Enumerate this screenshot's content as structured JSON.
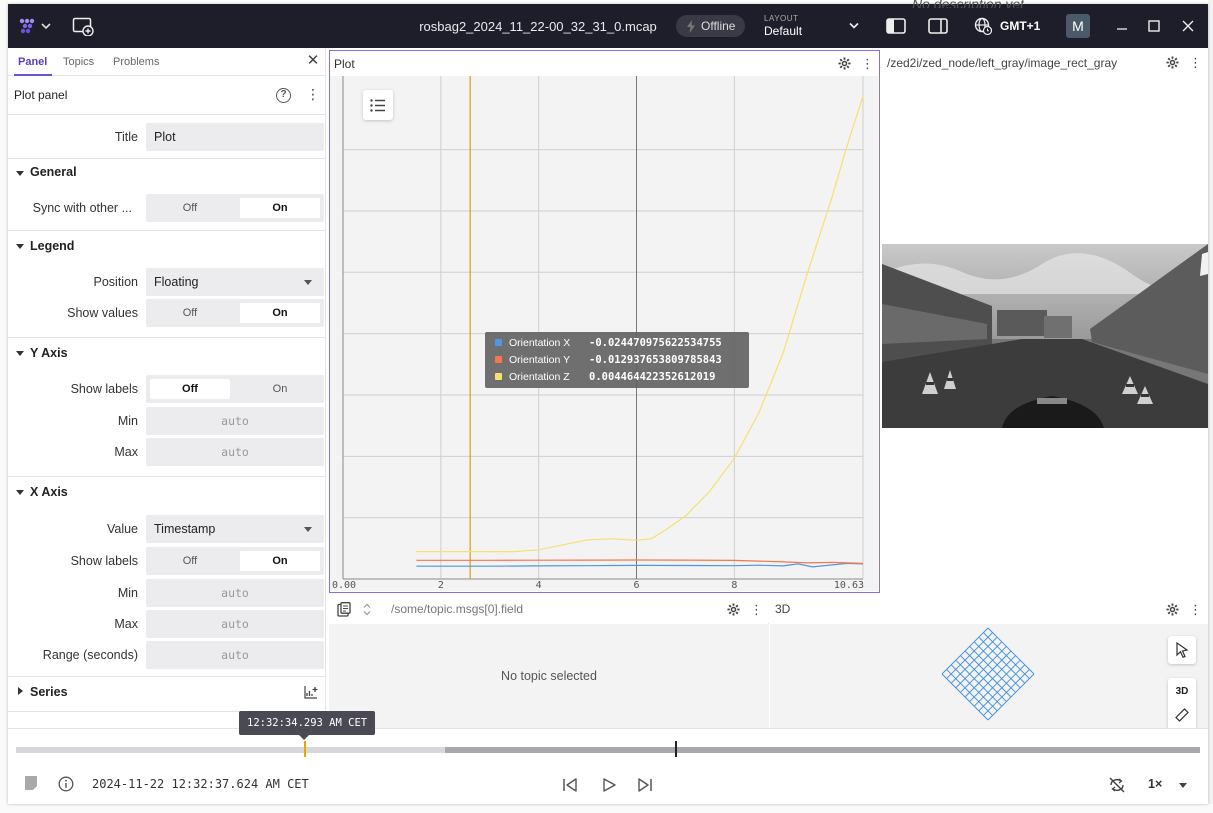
{
  "titlebar": {
    "file_name": "rosbag2_2024_11_22-00_32_31_0.mcap",
    "connection_status": "Offline",
    "layout_caption": "LAYOUT",
    "layout_value": "Default",
    "timezone": "GMT+1",
    "user_initial": "M",
    "behind_text": "No description yet"
  },
  "sidebar": {
    "tabs": [
      "Panel",
      "Topics",
      "Problems"
    ],
    "active_tab": "Panel",
    "header_title": "Plot panel",
    "help_symbol": "?",
    "title_label": "Title",
    "title_value": "Plot",
    "general": {
      "heading": "General",
      "sync_label": "Sync with other ...",
      "sync_off": "Off",
      "sync_on": "On",
      "sync_selected": "On"
    },
    "legend": {
      "heading": "Legend",
      "position_label": "Position",
      "position_value": "Floating",
      "show_values_label": "Show values",
      "off": "Off",
      "on": "On",
      "show_values_selected": "On"
    },
    "y_axis": {
      "heading": "Y Axis",
      "show_labels_label": "Show labels",
      "off": "Off",
      "on": "On",
      "show_labels_selected": "Off",
      "min_label": "Min",
      "min_value": "auto",
      "max_label": "Max",
      "max_value": "auto"
    },
    "x_axis": {
      "heading": "X Axis",
      "value_label": "Value",
      "value_value": "Timestamp",
      "show_labels_label": "Show labels",
      "off": "Off",
      "on": "On",
      "show_labels_selected": "On",
      "min_label": "Min",
      "min_value": "auto",
      "max_label": "Max",
      "max_value": "auto",
      "range_label": "Range (seconds)",
      "range_value": "auto"
    },
    "series": {
      "heading": "Series"
    }
  },
  "plot_panel": {
    "title": "Plot",
    "tooltip": [
      {
        "name": "Orientation X",
        "value": "-0.024470975622534755",
        "color": "#4e98e2"
      },
      {
        "name": "Orientation Y",
        "value": "-0.012937653809785843",
        "color": "#f5774d"
      },
      {
        "name": "Orientation Z",
        "value": "0.004464422352612019",
        "color": "#f7df71"
      }
    ]
  },
  "chart_data": {
    "type": "line",
    "title": "",
    "xlabel": "",
    "ylabel": "",
    "xlim": [
      0.0,
      10.63
    ],
    "x_tick_labels": [
      "0.00",
      "2",
      "4",
      "6",
      "8",
      "10.63"
    ],
    "x_ticks": [
      0,
      2,
      4,
      6,
      8,
      10.63
    ],
    "y_show_labels": false,
    "ylim": [
      -0.05,
      0.95
    ],
    "hover_x": 2.6,
    "grid": true,
    "legend": "top-left toggle",
    "series": [
      {
        "name": "Orientation X",
        "color": "#4e98e2",
        "x": [
          1.5,
          2.0,
          2.6,
          3.0,
          4.0,
          5.0,
          6.0,
          7.0,
          8.0,
          8.5,
          9.0,
          9.3,
          9.6,
          10.0,
          10.3,
          10.63
        ],
        "y": [
          -0.0245,
          -0.0245,
          -0.0245,
          -0.0245,
          -0.024,
          -0.0235,
          -0.023,
          -0.0232,
          -0.0235,
          -0.0225,
          -0.024,
          -0.02,
          -0.026,
          -0.022,
          -0.019,
          -0.02
        ]
      },
      {
        "name": "Orientation Y",
        "color": "#f5774d",
        "x": [
          1.5,
          2.0,
          2.6,
          3.0,
          4.0,
          5.0,
          6.0,
          7.0,
          8.0,
          8.5,
          9.0,
          9.5,
          10.0,
          10.63
        ],
        "y": [
          -0.0129,
          -0.0129,
          -0.0129,
          -0.0129,
          -0.0127,
          -0.0125,
          -0.0122,
          -0.0124,
          -0.013,
          -0.0145,
          -0.016,
          -0.018,
          -0.017,
          -0.019
        ]
      },
      {
        "name": "Orientation Z",
        "color": "#f7df71",
        "x": [
          1.5,
          2.6,
          3.5,
          4.0,
          4.5,
          5.0,
          5.5,
          6.0,
          6.3,
          6.6,
          7.0,
          7.5,
          8.0,
          8.5,
          9.0,
          9.5,
          10.0,
          10.3,
          10.63
        ],
        "y": [
          0.0045,
          0.0045,
          0.0045,
          0.008,
          0.018,
          0.028,
          0.03,
          0.027,
          0.03,
          0.048,
          0.075,
          0.125,
          0.19,
          0.28,
          0.4,
          0.56,
          0.71,
          0.81,
          0.91
        ]
      }
    ]
  },
  "image_panel": {
    "topic": "/zed2i/zed_node/left_gray/image_rect_gray"
  },
  "raw_panel": {
    "path_placeholder": "/some/topic.msgs[0].field",
    "empty_text": "No topic selected"
  },
  "three_panel": {
    "title": "3D",
    "mode_button": "3D"
  },
  "playback": {
    "hover_time": "12:32:34.293 AM CET",
    "current_time": "2024-11-22 12:32:37.624 AM CET",
    "speed": "1×",
    "progress_loaded_start": 0.363,
    "hover_fraction": 0.243,
    "cursor_fraction": 0.557
  }
}
